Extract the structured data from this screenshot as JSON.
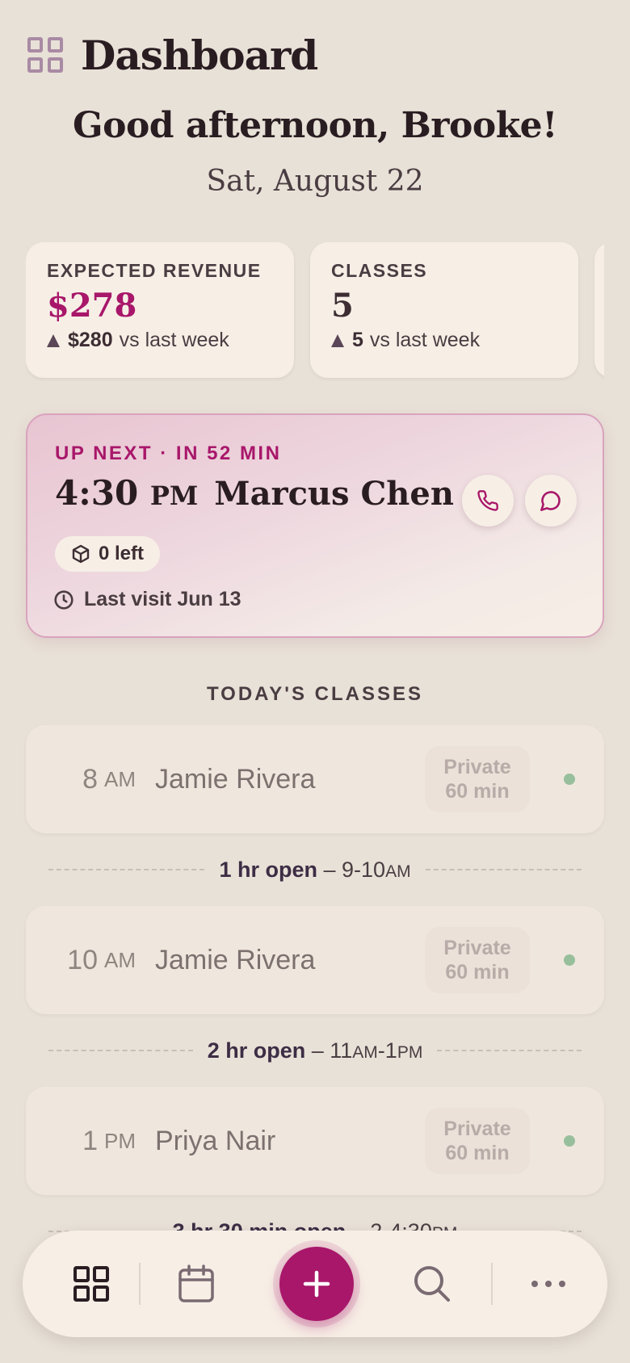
{
  "header": {
    "title": "Dashboard"
  },
  "greeting": "Good afternoon, Brooke!",
  "date": "Sat, August 22",
  "stats": [
    {
      "label": "EXPECTED REVENUE",
      "value": "$278",
      "delta_value": "$280",
      "delta_text": "vs last week"
    },
    {
      "label": "CLASSES",
      "value": "5",
      "delta_value": "5",
      "delta_text": "vs last week"
    }
  ],
  "up_next": {
    "label": "UP NEXT · IN 52 MIN",
    "time": "4:30",
    "ampm": "PM",
    "name": "Marcus Chen",
    "packages_left": "0 left",
    "last_visit": "Last visit Jun 13"
  },
  "section_title": "TODAY'S CLASSES",
  "classes": [
    {
      "time": "8",
      "ampm": "AM",
      "name": "Jamie Rivera",
      "type": "Private",
      "duration": "60 min"
    },
    {
      "time": "10",
      "ampm": "AM",
      "name": "Jamie Rivera",
      "type": "Private",
      "duration": "60 min"
    },
    {
      "time": "1",
      "ampm": "PM",
      "name": "Priya Nair",
      "type": "Private",
      "duration": "60 min"
    }
  ],
  "gaps": [
    {
      "duration": "1 hr open",
      "dash": "–",
      "range": "9-10",
      "range_suffix": "AM"
    },
    {
      "duration": "2 hr open",
      "dash": "–",
      "range_start": "11",
      "start_suffix": "AM",
      "range_end": "-1",
      "end_suffix": "PM"
    },
    {
      "duration": "3 hr 30 min open",
      "dash": "–",
      "range": "2-4:30",
      "range_suffix": "PM"
    }
  ],
  "colors": {
    "accent": "#a8176a",
    "background": "#e8e1d7",
    "card": "#f7efe6",
    "status_dot": "#98bf9c"
  },
  "nav": {
    "items": [
      "dashboard-icon",
      "calendar-icon",
      "add-icon",
      "search-icon",
      "more-icon"
    ]
  }
}
